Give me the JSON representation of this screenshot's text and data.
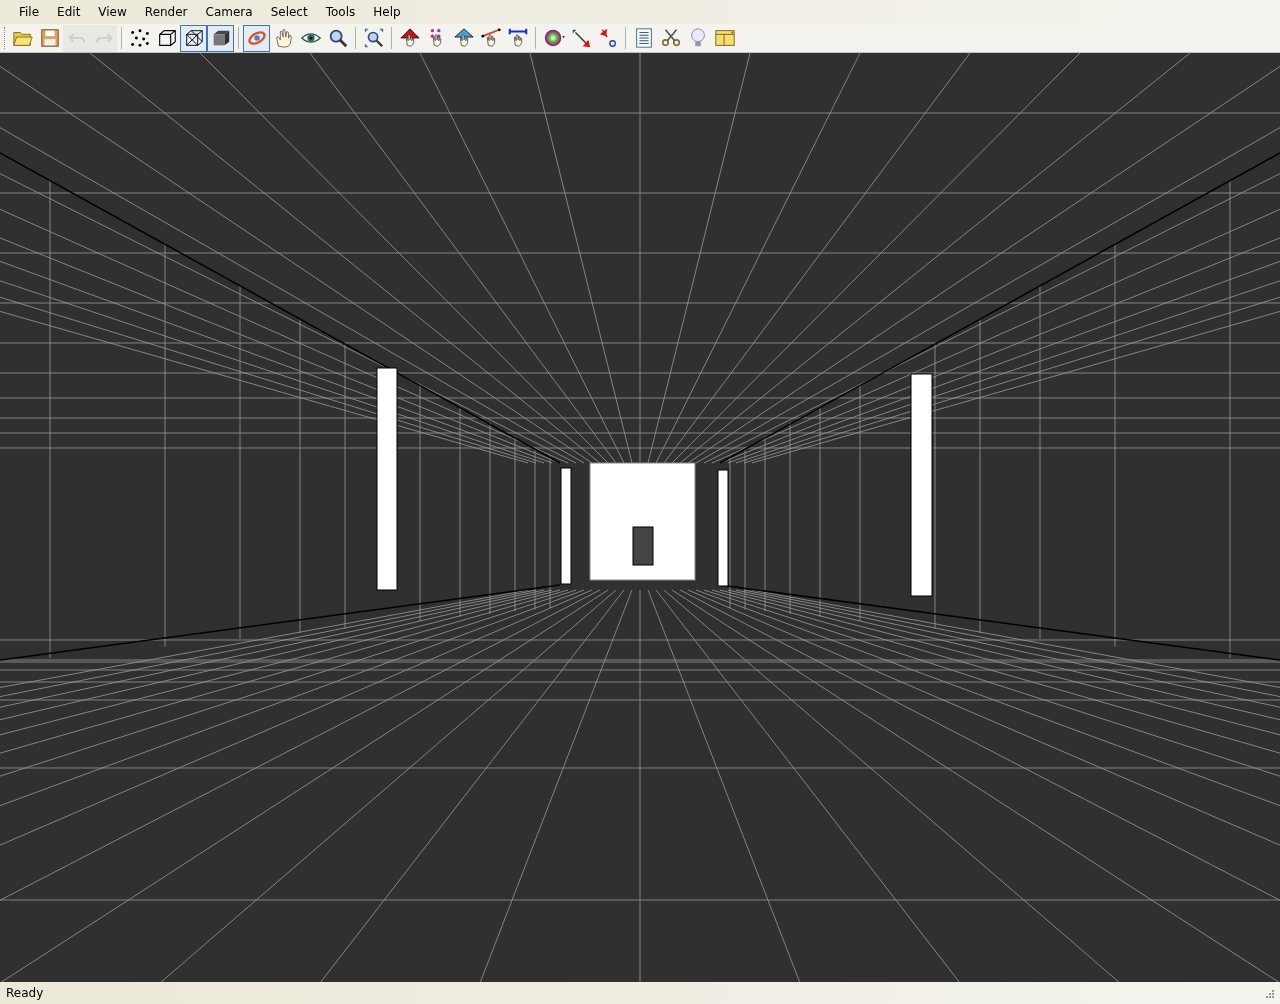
{
  "menu_bar": [
    "File",
    "Edit",
    "View",
    "Render",
    "Camera",
    "Select",
    "Tools",
    "Help"
  ],
  "toolbar": [
    [
      {
        "kind": "open",
        "selected": false,
        "disabled": false
      },
      {
        "kind": "save",
        "selected": false,
        "disabled": false
      },
      {
        "kind": "undo",
        "selected": false,
        "disabled": true
      },
      {
        "kind": "redo",
        "selected": false,
        "disabled": true
      }
    ],
    [
      {
        "kind": "points",
        "selected": false,
        "disabled": false
      },
      {
        "kind": "wireframe",
        "selected": false,
        "disabled": false
      },
      {
        "kind": "hiddenline",
        "selected": true,
        "disabled": false
      },
      {
        "kind": "shaded",
        "selected": true,
        "disabled": false
      }
    ],
    [
      {
        "kind": "orbit",
        "selected": true,
        "disabled": false
      },
      {
        "kind": "pan",
        "selected": false,
        "disabled": false
      },
      {
        "kind": "look",
        "selected": false,
        "disabled": false
      },
      {
        "kind": "zoom",
        "selected": false,
        "disabled": false
      }
    ],
    [
      {
        "kind": "fit",
        "selected": false,
        "disabled": false
      }
    ],
    [
      {
        "kind": "pickface",
        "selected": false,
        "disabled": false
      },
      {
        "kind": "pickvertex",
        "selected": false,
        "disabled": false
      },
      {
        "kind": "picktriangle",
        "selected": false,
        "disabled": false
      },
      {
        "kind": "pickedge",
        "selected": false,
        "disabled": false
      },
      {
        "kind": "pickborder",
        "selected": false,
        "disabled": false
      }
    ],
    [
      {
        "kind": "colorpick",
        "selected": false,
        "disabled": false
      },
      {
        "kind": "measure",
        "selected": false,
        "disabled": false
      },
      {
        "kind": "query",
        "selected": false,
        "disabled": false
      }
    ],
    [
      {
        "kind": "log",
        "selected": false,
        "disabled": false
      },
      {
        "kind": "cut",
        "selected": false,
        "disabled": false
      },
      {
        "kind": "light",
        "selected": false,
        "disabled": false
      },
      {
        "kind": "layers",
        "selected": false,
        "disabled": false
      }
    ]
  ],
  "status_bar": {
    "text": "Ready"
  }
}
